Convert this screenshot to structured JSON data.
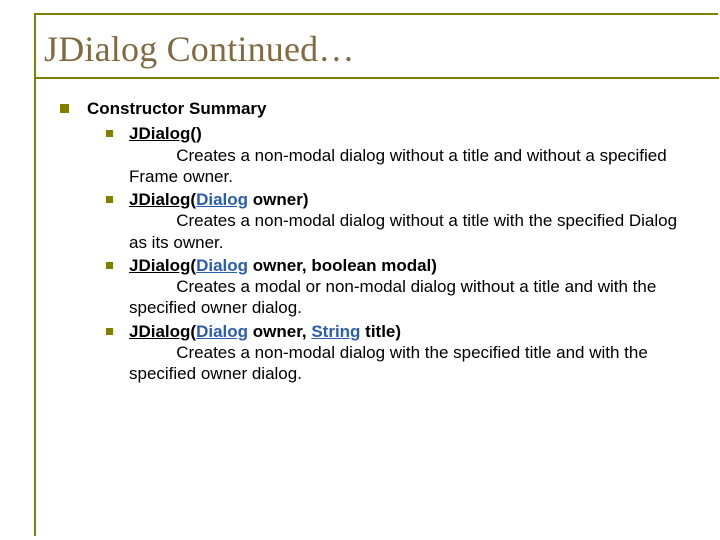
{
  "title": "JDialog Continued…",
  "heading": "Constructor Summary",
  "items": [
    {
      "method": "JDialog",
      "paren_open": "(",
      "params_pre": "",
      "params_link": "",
      "params_post": "",
      "paren_close": ")",
      "desc_indent": "          ",
      "desc": "Creates a non-modal dialog without a title and without a specified Frame owner."
    },
    {
      "method": "JDialog",
      "paren_open": "(",
      "params_pre": "",
      "params_link": "Dialog",
      "params_post": " owner",
      "paren_close": ")",
      "desc_indent": "          ",
      "desc": "Creates a non-modal dialog without a title with the specified Dialog as its owner."
    },
    {
      "method": "JDialog",
      "paren_open": "(",
      "params_pre": "",
      "params_link": "Dialog",
      "params_post": " owner, boolean modal",
      "paren_close": ")",
      "desc_indent": "          ",
      "desc": "Creates a modal or non-modal dialog without a title and with the specified owner dialog."
    },
    {
      "method": "JDialog",
      "paren_open": "(",
      "params_pre": "",
      "params_link": "Dialog",
      "params_post": " owner, ",
      "params_link2": "String",
      "params_post2": " title",
      "paren_close": ")",
      "desc_indent": "          ",
      "desc": "Creates a non-modal dialog with the specified title and with the specified owner dialog."
    }
  ]
}
